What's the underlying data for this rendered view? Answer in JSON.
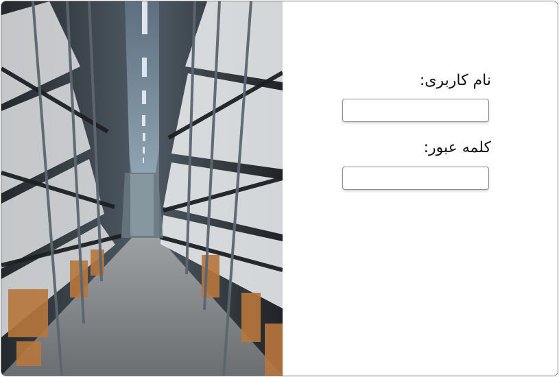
{
  "login_form": {
    "username_label": "نام کاربری:",
    "username_value": "",
    "password_label": "کلمه عبور:",
    "password_value": ""
  },
  "visuals": {
    "photo_subject": "warehouse-aisle-image",
    "border_color": "#7a7a7a",
    "background_color": "#ffffff"
  }
}
